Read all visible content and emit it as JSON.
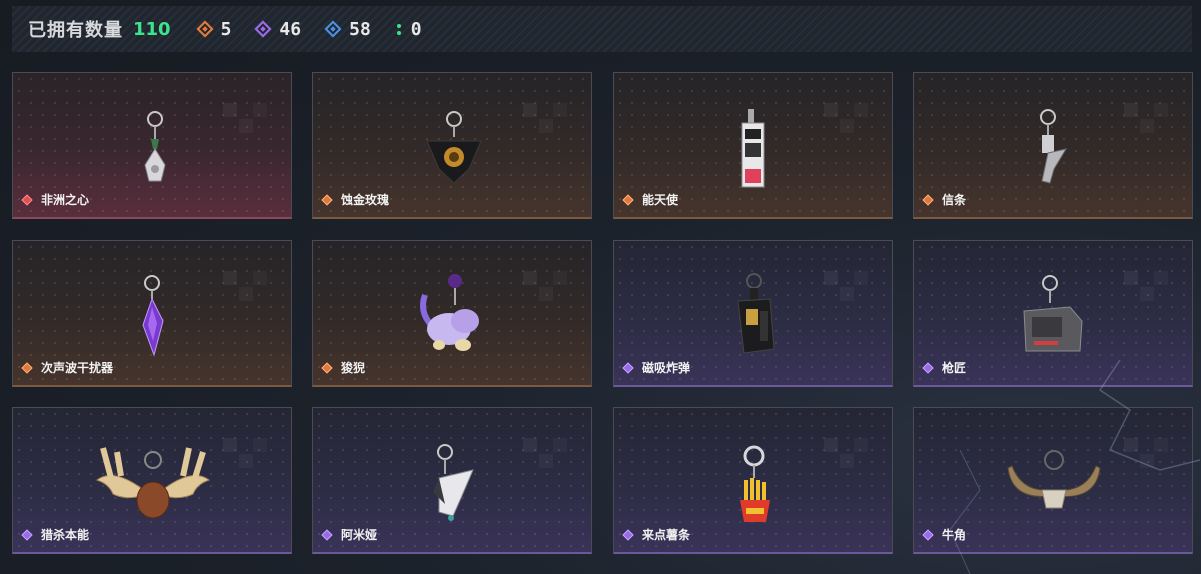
{
  "header": {
    "owned_label": "已拥有数量",
    "owned_count": "110",
    "stats": [
      {
        "icon": "orange-diamond-icon",
        "color": "#e07a3c",
        "value": "5"
      },
      {
        "icon": "purple-diamond-icon",
        "color": "#9a6ae8",
        "value": "46"
      },
      {
        "icon": "blue-diamond-icon",
        "color": "#4a8ee0",
        "value": "58"
      },
      {
        "icon": "green-diamond-icon",
        "color": "#3ee38e",
        "value": "0"
      }
    ]
  },
  "items": [
    {
      "name": "非洲之心",
      "rarity": "red",
      "icon": "white-pendant-charm-icon"
    },
    {
      "name": "蚀金玫瑰",
      "rarity": "orange",
      "icon": "black-rose-charm-icon"
    },
    {
      "name": "能天使",
      "rarity": "orange",
      "icon": "tag-card-charm-icon"
    },
    {
      "name": "信条",
      "rarity": "orange",
      "icon": "blade-charm-icon"
    },
    {
      "name": "次声波干扰器",
      "rarity": "orange",
      "icon": "purple-crystal-charm-icon"
    },
    {
      "name": "狻猊",
      "rarity": "orange",
      "icon": "lion-figure-charm-icon"
    },
    {
      "name": "磁吸炸弹",
      "rarity": "purple",
      "icon": "bomb-charm-icon"
    },
    {
      "name": "枪匠",
      "rarity": "purple",
      "icon": "workbench-charm-icon"
    },
    {
      "name": "猎杀本能",
      "rarity": "purple",
      "icon": "moose-antler-charm-icon"
    },
    {
      "name": "阿米娅",
      "rarity": "purple",
      "icon": "rabbit-hood-charm-icon"
    },
    {
      "name": "来点薯条",
      "rarity": "purple",
      "icon": "french-fries-charm-icon"
    },
    {
      "name": "牛角",
      "rarity": "purple",
      "icon": "bull-horn-charm-icon"
    }
  ]
}
